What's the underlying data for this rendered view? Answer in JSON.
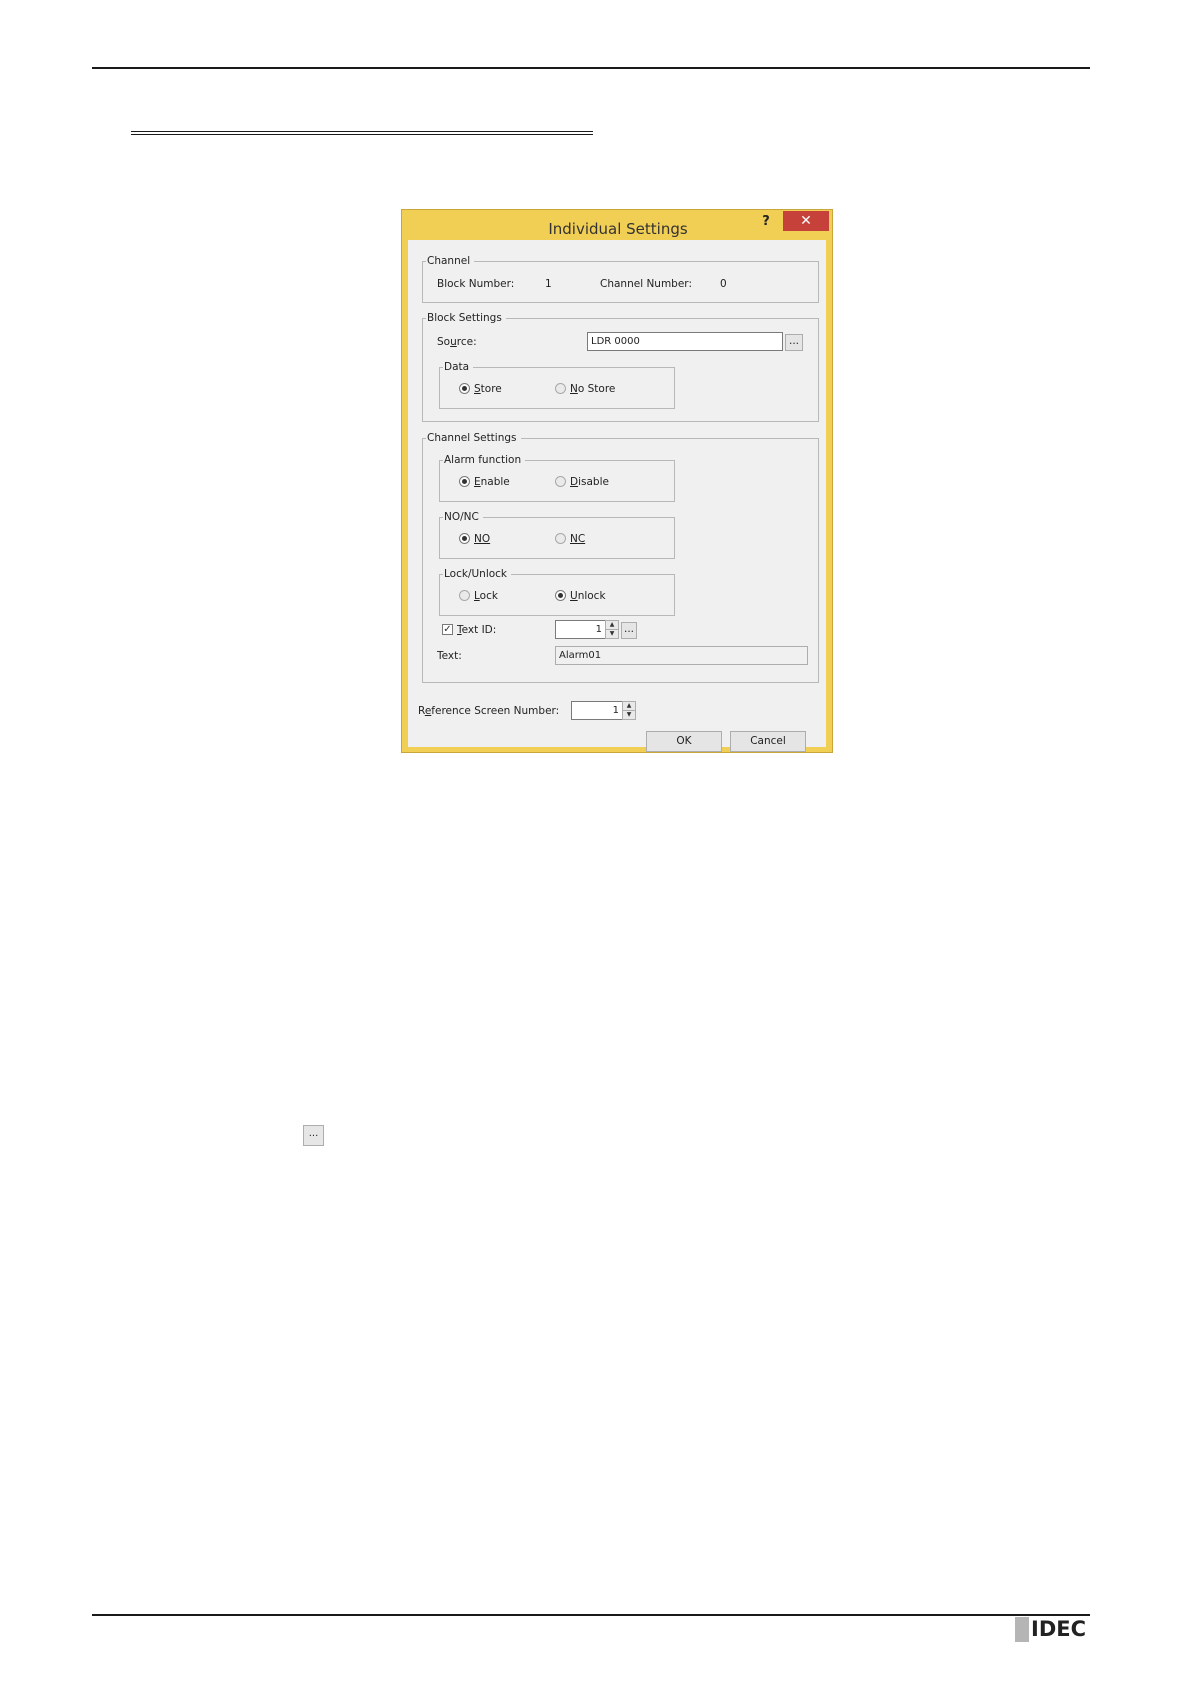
{
  "dialog": {
    "title": "Individual Settings",
    "help_label": "?",
    "close_label": "✕",
    "channel": {
      "legend": "Channel",
      "block_number_label": "Block Number:",
      "block_number_value": "1",
      "channel_number_label": "Channel Number:",
      "channel_number_value": "0"
    },
    "block_settings": {
      "legend": "Block Settings",
      "source_label_pre": "So",
      "source_label_u": "u",
      "source_label_post": "rce:",
      "source_value": "LDR 0000",
      "browse_label": "...",
      "data": {
        "legend": "Data",
        "store_u": "S",
        "store_rest": "tore",
        "no_store_u": "N",
        "no_store_rest": "o Store"
      }
    },
    "channel_settings": {
      "legend": "Channel Settings",
      "alarm": {
        "legend": "Alarm function",
        "enable_u": "E",
        "enable_rest": "nable",
        "disable_u": "D",
        "disable_rest": "isable"
      },
      "nonc": {
        "legend": "NO/NC",
        "no_label": "NO",
        "nc_label": "NC"
      },
      "lock": {
        "legend": "Lock/Unlock",
        "lock_u": "L",
        "lock_rest": "ock",
        "unlock_u": "U",
        "unlock_rest": "nlock"
      },
      "text_id_u": "T",
      "text_id_rest": "ext ID:",
      "text_id_value": "1",
      "text_id_browse": "...",
      "text_label": "Text:",
      "text_value": "Alarm01"
    },
    "ref_screen_pre": "R",
    "ref_screen_u": "e",
    "ref_screen_post": "ference Screen Number:",
    "ref_screen_value": "1",
    "ok_label": "OK",
    "cancel_label": "Cancel"
  },
  "inline_button_label": "...",
  "logo_text": "IDEC"
}
